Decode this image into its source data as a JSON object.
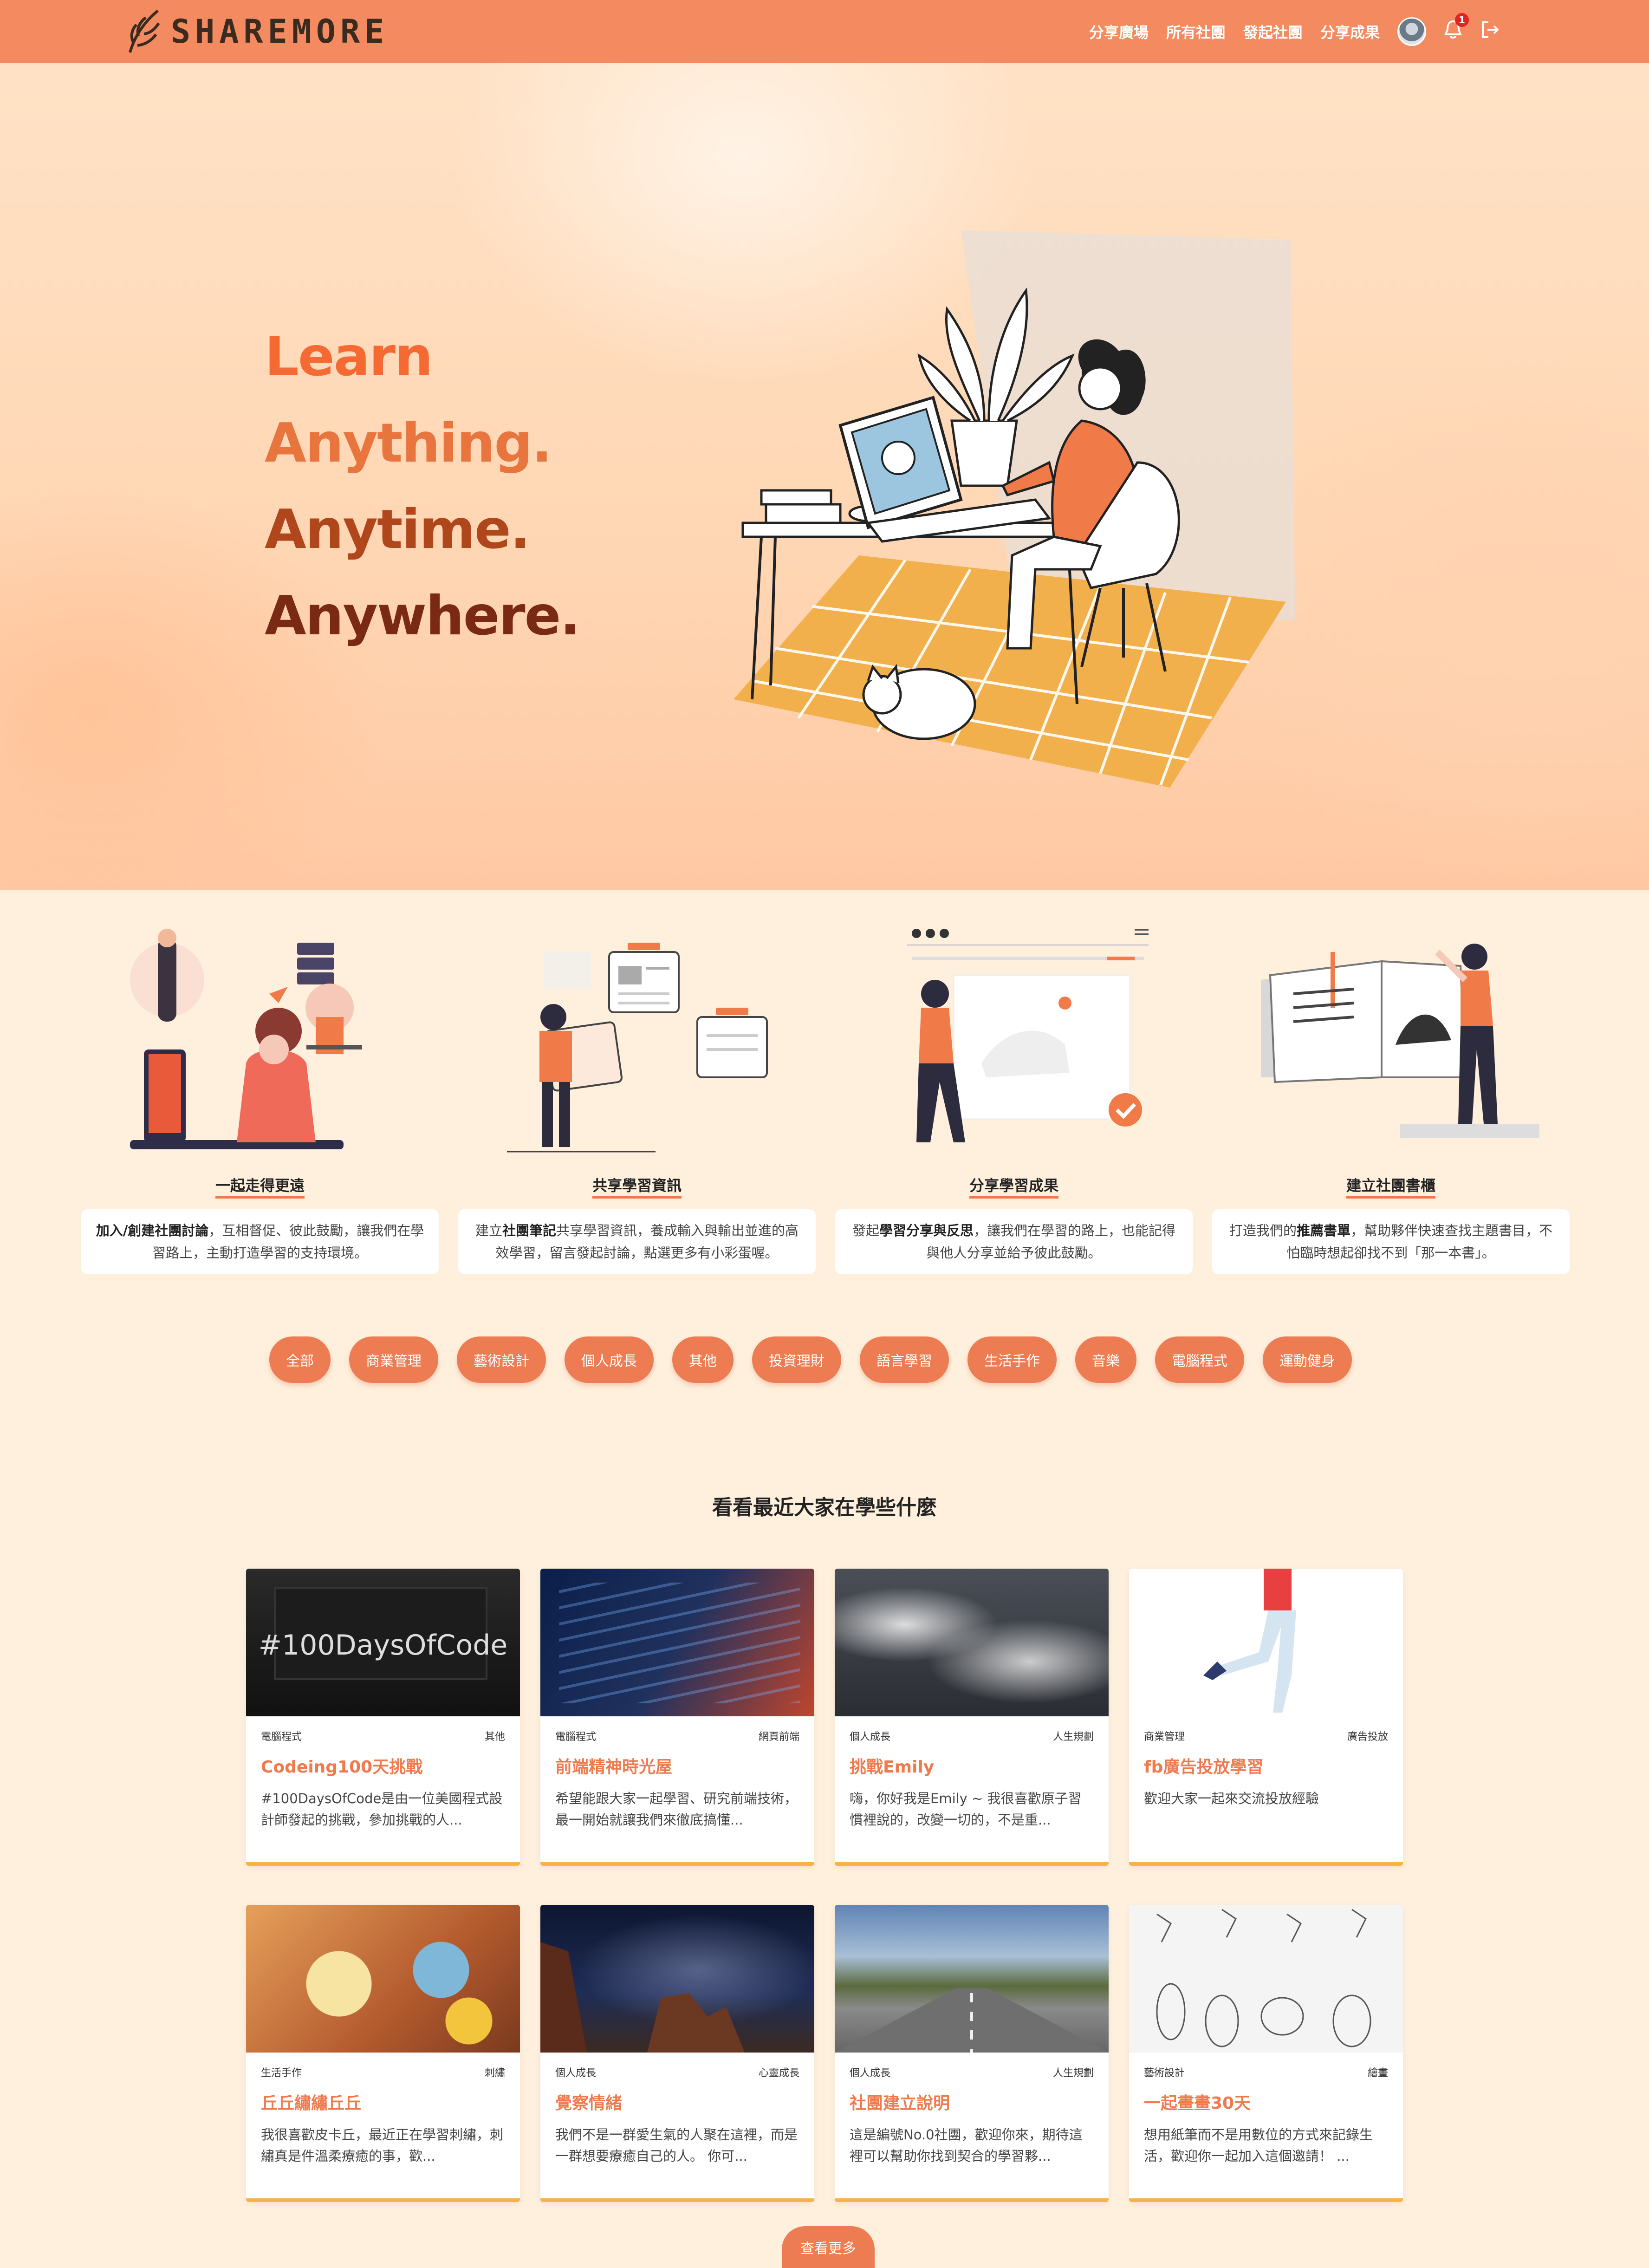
{
  "nav": {
    "logo_text": "SHAREMORE",
    "links": [
      "分享廣場",
      "所有社團",
      "發起社團",
      "分享成果"
    ],
    "notification_count": "1",
    "bell_icon": "bell-icon",
    "logout_icon": "logout-icon"
  },
  "hero": {
    "lines": [
      "Learn",
      "Anything.",
      "Anytime.",
      "Anywhere."
    ]
  },
  "features": [
    {
      "title": "一起走得更遠",
      "desc_bold": "加入/創建社團討論",
      "desc": "，互相督促、彼此鼓勵，讓我們在學習路上，主動打造學習的支持環境。"
    },
    {
      "title": "共享學習資訊",
      "desc_pre": "建立",
      "desc_bold": "社團筆記",
      "desc": "共享學習資訊，養成輸入與輸出並進的高效學習，留言發起討論，點選更多有小彩蛋喔。"
    },
    {
      "title": "分享學習成果",
      "desc_pre": "發起",
      "desc_bold": "學習分享與反思",
      "desc": "，讓我們在學習的路上，也能記得與他人分享並給予彼此鼓勵。"
    },
    {
      "title": "建立社團書櫃",
      "desc_pre": "打造我們的",
      "desc_bold": "推薦書單",
      "desc": "，幫助夥伴快速查找主題書目，不怕臨時想起卻找不到「那一本書」。"
    }
  ],
  "tags": [
    "全部",
    "商業管理",
    "藝術設計",
    "個人成長",
    "其他",
    "投資理財",
    "語言學習",
    "生活手作",
    "音樂",
    "電腦程式",
    "運動健身"
  ],
  "recent": {
    "title": "看看最近大家在學些什麼",
    "cards": [
      {
        "category": "電腦程式",
        "sub": "其他",
        "title": "Codeing100天挑戰",
        "desc": "#100DaysOfCode是由一位美國程式設計師發起的挑戰，參加挑戰的人...",
        "img_text": "#100DaysOfCode"
      },
      {
        "category": "電腦程式",
        "sub": "網頁前端",
        "title": "前端精神時光屋",
        "desc": "希望能跟大家一起學習、研究前端技術，最一開始就讓我們來徹底搞懂..."
      },
      {
        "category": "個人成長",
        "sub": "人生規劃",
        "title": "挑戰Emily",
        "desc": "嗨，你好我是Emily ~ 我很喜歡原子習慣裡說的，改變一切的，不是重..."
      },
      {
        "category": "商業管理",
        "sub": "廣告投放",
        "title": "fb廣告投放學習",
        "desc": "歡迎大家一起來交流投放經驗"
      },
      {
        "category": "生活手作",
        "sub": "刺繡",
        "title": "丘丘繡繡丘丘",
        "desc": "我很喜歡皮卡丘，最近正在學習刺繡，刺繡真是件溫柔療癒的事，歡..."
      },
      {
        "category": "個人成長",
        "sub": "心靈成長",
        "title": "覺察情緒",
        "desc": "我們不是一群愛生氣的人聚在這裡，而是一群想要療癒自己的人。 你可..."
      },
      {
        "category": "個人成長",
        "sub": "人生規劃",
        "title": "社團建立說明",
        "desc": "這是編號No.0社團，歡迎你來，期待這裡可以幫助你找到契合的學習夥..."
      },
      {
        "category": "藝術設計",
        "sub": "繪畫",
        "title": "一起畫畫30天",
        "desc": "想用紙筆而不是用數位的方式來記錄生活，歡迎你一起加入這個邀請！ ..."
      }
    ],
    "more_label": "查看更多"
  },
  "colors": {
    "brand": "#f48a60",
    "accent": "#ee7c52",
    "card_border": "#f7b24a"
  }
}
